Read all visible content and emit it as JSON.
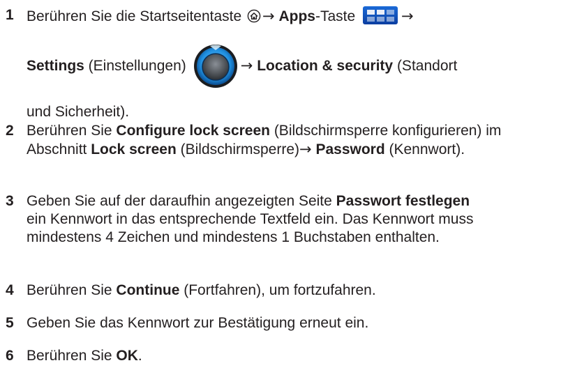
{
  "steps": [
    {
      "number": "1",
      "line1": {
        "t1": "Berühren Sie die Startseitentaste ",
        "arrow1": "→",
        "bold1": "Apps",
        "t2": "-Taste ",
        "arrow2": "→"
      },
      "line2": {
        "bold1": "Settings",
        "t1": " (Einstellungen)",
        "arrow": "→",
        "bold2": "Location & security",
        "t2": " (Standort"
      },
      "line3": {
        "t1": "und Sicherheit)."
      }
    },
    {
      "number": "2",
      "t1": "Berühren Sie ",
      "bold1": "Configure lock screen",
      "t2": " (Bildschirmsperre konfigurieren) im Abschnitt ",
      "bold2": "Lock screen",
      "t3": " (Bildschirmsperre)",
      "arrow": "→",
      "bold3": "Password",
      "t4": " (Kennwort)."
    },
    {
      "number": "3",
      "t1": "Geben Sie auf der daraufhin angezeigten Seite ",
      "bold1": "Passwort festlegen",
      "t2": " ein Kennwort in das entsprechende Textfeld ein. Das Kennwort muss mindestens 4 Zeichen und mindestens 1 Buchstaben enthalten."
    },
    {
      "number": "4",
      "t1": "Berühren Sie ",
      "bold1": "Continue",
      "t2": " (Fortfahren), um fortzufahren."
    },
    {
      "number": "5",
      "t1": "Geben Sie das Kennwort zur Bestätigung erneut ein."
    },
    {
      "number": "6",
      "t1": "Berühren Sie ",
      "bold1": "OK",
      "t2": "."
    }
  ],
  "icons": {
    "home": "home-icon",
    "apps": "apps-icon",
    "settings": "settings-icon"
  },
  "colors": {
    "text": "#231f20",
    "apps_blue": "#1b6ad7",
    "settings_ring": "#2a9be0"
  }
}
